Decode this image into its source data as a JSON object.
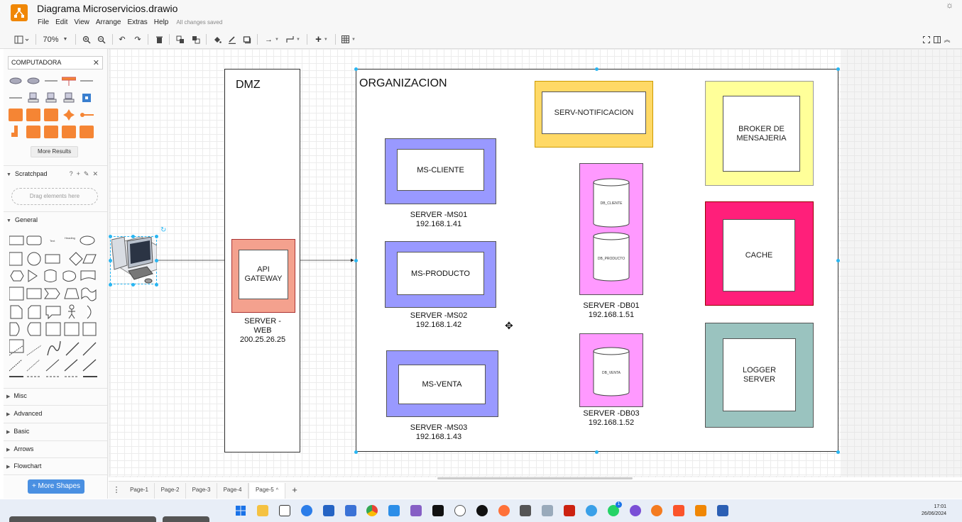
{
  "window": {
    "doc_title": "Diagrama Microservicios.drawio",
    "menu": [
      "File",
      "Edit",
      "View",
      "Arrange",
      "Extras",
      "Help"
    ],
    "save_status": "All changes saved"
  },
  "toolbar": {
    "zoom": "70%"
  },
  "sidebar": {
    "search_value": "COMPUTADORA",
    "more_results": "More Results",
    "scratchpad_title": "Scratchpad",
    "scratchpad_drop": "Drag elements here",
    "sections": [
      "General",
      "Misc",
      "Advanced",
      "Basic",
      "Arrows",
      "Flowchart"
    ],
    "more_shapes": "+ More Shapes",
    "general_text_sample": "Text",
    "general_heading_sample": "Heading"
  },
  "diagram": {
    "dmz_title": "DMZ",
    "org_title": "ORGANIZACION",
    "api_gateway": "API GATEWAY",
    "server_web": "SERVER -\nWEB\n200.25.26.25",
    "ms_cliente": "MS-CLIENTE",
    "server_ms01": "SERVER -MS01\n192.168.1.41",
    "ms_producto": "MS-PRODUCTO",
    "server_ms02": "SERVER -MS02\n192.168.1.42",
    "ms_venta": "MS-VENTA",
    "server_ms03": "SERVER -MS03\n192.168.1.43",
    "serv_notificacion": "SERV-NOTIFICACION",
    "db_cliente": "DB_CLIENTE",
    "db_producto": "DB_PRODUCTO",
    "db_venta": "DB_VENTA",
    "server_db01": "SERVER -DB01\n192.168.1.51",
    "server_db03": "SERVER -DB03\n192.168.1.52",
    "broker": "BROKER DE\nMENSAJERIA",
    "cache": "CACHE",
    "logger": "LOGGER\nSERVER"
  },
  "colors": {
    "api_gateway_fill": "#f4a18e",
    "ms_fill": "#9999ff",
    "db_fill": "#ff99ff",
    "notif_fill": "#ffd966",
    "broker_fill": "#ffff99",
    "cache_fill": "#ff1f7a",
    "logger_fill": "#9ac3bf",
    "accent": "#f08705"
  },
  "pages": {
    "tabs": [
      "Page-1",
      "Page-2",
      "Page-3",
      "Page-4",
      "Page-5"
    ],
    "active": "Page-5"
  },
  "taskbar": {
    "time": "17:01",
    "date": "26/06/2024",
    "whatsapp_badge": "1"
  }
}
